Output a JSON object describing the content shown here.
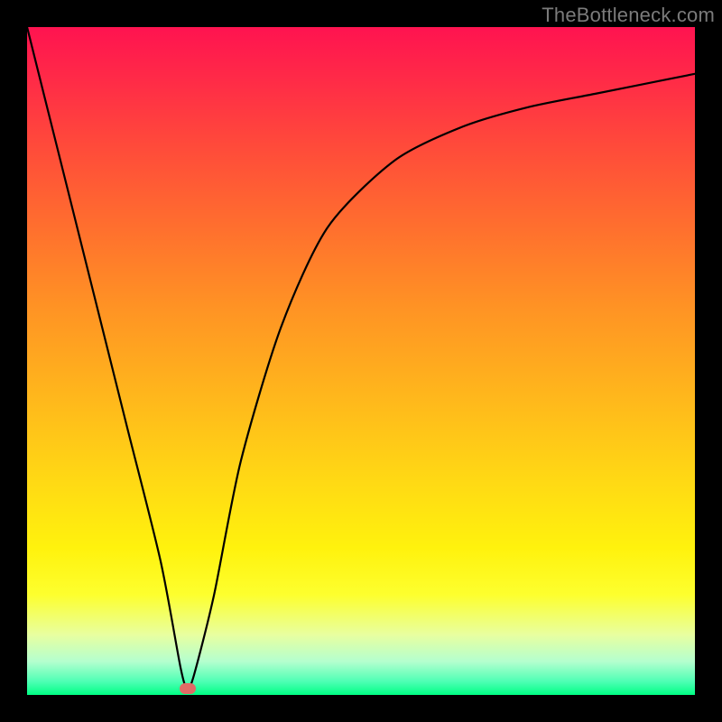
{
  "watermark": "TheBottleneck.com",
  "colors": {
    "frame": "#000000",
    "gradient_top": "#ff1350",
    "gradient_bottom": "#00ff84",
    "curve": "#000000",
    "marker": "#e06b66",
    "watermark_text": "#7b7b7b"
  },
  "chart_data": {
    "type": "line",
    "title": "",
    "xlabel": "",
    "ylabel": "",
    "xlim": [
      0,
      100
    ],
    "ylim": [
      0,
      100
    ],
    "grid": false,
    "legend": false,
    "annotations": [
      {
        "text": "TheBottleneck.com",
        "position": "top-right"
      }
    ],
    "series": [
      {
        "name": "bottleneck-curve",
        "x": [
          0,
          5,
          10,
          15,
          20,
          23,
          24,
          25,
          28,
          32,
          38,
          45,
          55,
          65,
          75,
          85,
          95,
          100
        ],
        "values": [
          100,
          80,
          60,
          40,
          20,
          4,
          1,
          3,
          15,
          35,
          55,
          70,
          80,
          85,
          88,
          90,
          92,
          93
        ]
      }
    ],
    "marker": {
      "x": 24,
      "y": 1
    }
  }
}
